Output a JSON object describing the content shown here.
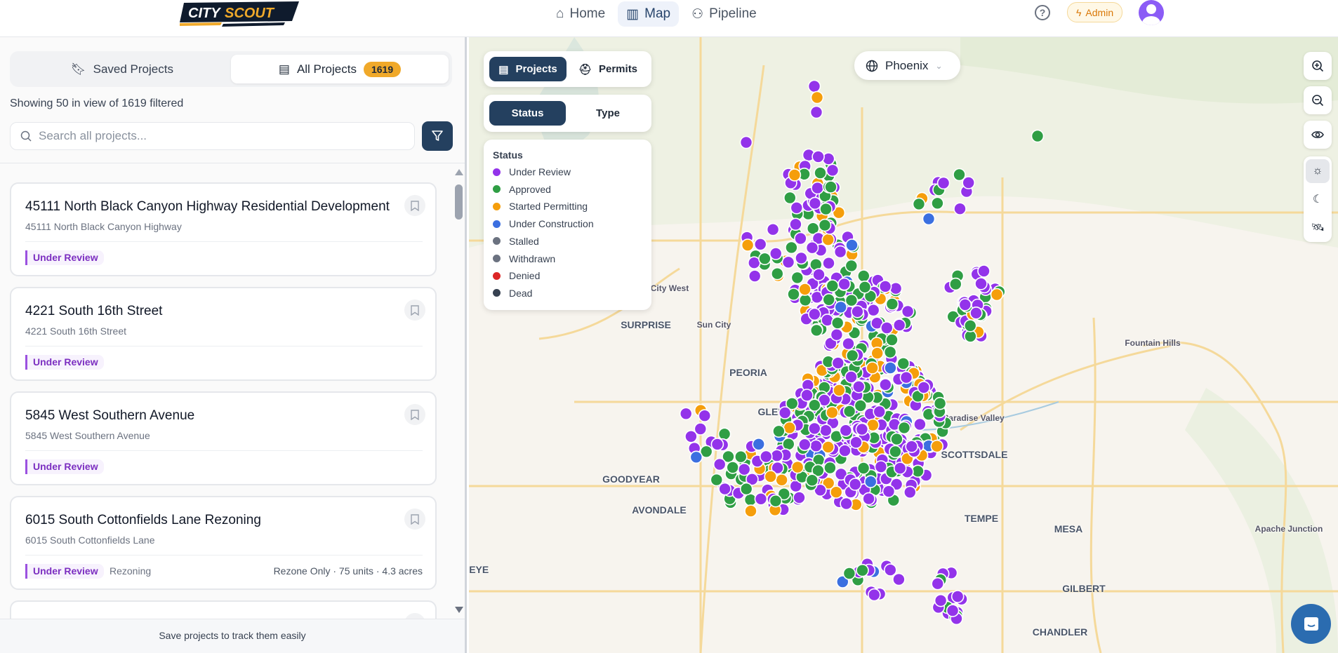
{
  "header": {
    "logo_text": "CITYSCOUT",
    "nav": [
      {
        "label": "Home",
        "icon": "home-icon"
      },
      {
        "label": "Map",
        "icon": "map-icon",
        "active": true
      },
      {
        "label": "Pipeline",
        "icon": "users-icon"
      }
    ],
    "help": "?",
    "admin_label": "Admin"
  },
  "sidebar": {
    "tabs": [
      {
        "label": "Saved Projects"
      },
      {
        "label": "All Projects",
        "count": "1619",
        "active": true
      }
    ],
    "showing": "Showing 50 in view of 1619 filtered",
    "search_placeholder": "Search all projects...",
    "cards": [
      {
        "title": "45111 North Black Canyon Highway Residential Development",
        "address": "45111 North Black Canyon Highway",
        "status": "Under Review",
        "type": "",
        "meta": ""
      },
      {
        "title": "4221 South 16th Street",
        "address": "4221 South 16th Street",
        "status": "Under Review",
        "type": "",
        "meta": ""
      },
      {
        "title": "5845 West Southern Avenue",
        "address": "5845 West Southern Avenue",
        "status": "Under Review",
        "type": "",
        "meta": ""
      },
      {
        "title": "6015 South Cottonfields Lane Rezoning",
        "address": "6015 South Cottonfields Lane",
        "status": "Under Review",
        "type": "Rezoning",
        "meta": "Rezone Only · 75 units · 4.3 acres"
      },
      {
        "title": "1518 E Paradise Ln #1 (Active) Use Permit",
        "address": "",
        "status": "",
        "type": "",
        "meta": ""
      }
    ],
    "footer": "Save projects to track them easily"
  },
  "map": {
    "layer_toggle": [
      "Projects",
      "Permits"
    ],
    "color_toggle": [
      "Status",
      "Type"
    ],
    "legend": {
      "title": "Status",
      "items": [
        {
          "label": "Under Review",
          "color": "#9333ea"
        },
        {
          "label": "Approved",
          "color": "#2f9e44"
        },
        {
          "label": "Started Permitting",
          "color": "#f59e0b"
        },
        {
          "label": "Under Construction",
          "color": "#3b6fe0"
        },
        {
          "label": "Stalled",
          "color": "#6b7280"
        },
        {
          "label": "Withdrawn",
          "color": "#6b7280"
        },
        {
          "label": "Denied",
          "color": "#dc2626"
        },
        {
          "label": "Dead",
          "color": "#374151"
        }
      ]
    },
    "city": "Phoenix",
    "labels": {
      "city_west": "City West",
      "surprise": "SURPRISE",
      "sun_city": "Sun City",
      "peoria": "PEORIA",
      "glendale": "GLENDALE",
      "paradise_valley": "Paradise Valley",
      "scottsdale": "SCOTTSDALE",
      "goodyear": "GOODYEAR",
      "avondale": "AVONDALE",
      "tempe": "TEMPE",
      "mesa": "MESA",
      "fountain_hills": "Fountain Hills",
      "apache_junction": "Apache Junction",
      "gilbert": "GILBERT",
      "chandler": "CHANDLER",
      "buckeye": "BUCKEYE"
    }
  }
}
